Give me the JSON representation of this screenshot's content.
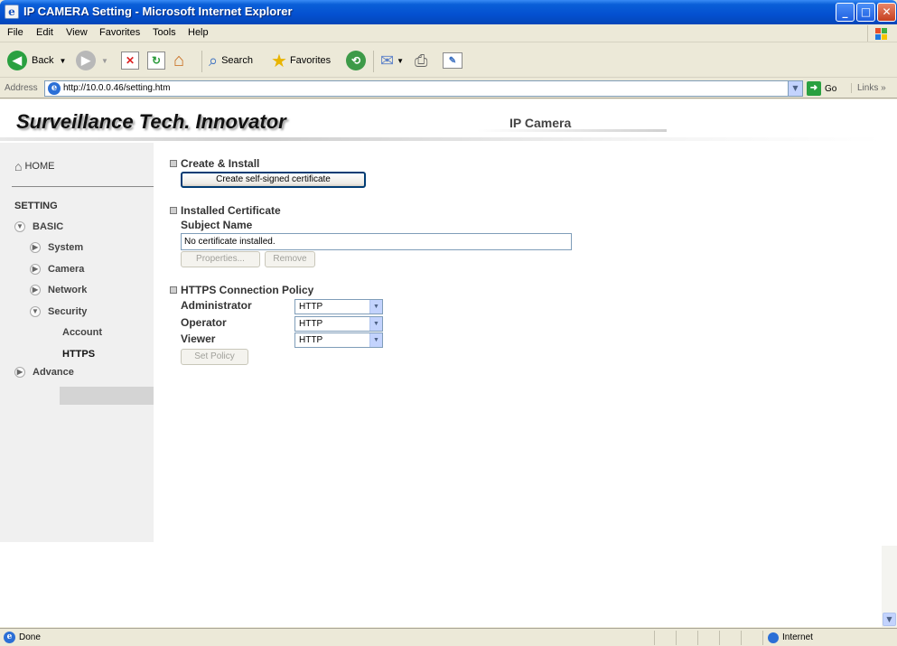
{
  "window": {
    "title": "IP CAMERA Setting - Microsoft Internet Explorer"
  },
  "menu": [
    "File",
    "Edit",
    "View",
    "Favorites",
    "Tools",
    "Help"
  ],
  "toolbar": {
    "back": "Back",
    "search": "Search",
    "favorites": "Favorites"
  },
  "address": {
    "label": "Address",
    "url": "http://10.0.0.46/setting.htm",
    "go": "Go",
    "links": "Links"
  },
  "banner": {
    "title": "Surveillance Tech. Innovator",
    "product": "IP Camera"
  },
  "sidebar": {
    "home": "HOME",
    "setting": "SETTING",
    "basic": "BASIC",
    "system": "System",
    "camera": "Camera",
    "network": "Network",
    "security": "Security",
    "account": "Account",
    "https": "HTTPS",
    "advance": "Advance"
  },
  "create": {
    "heading": "Create & Install",
    "button": "Create self-signed certificate"
  },
  "installed": {
    "heading": "Installed Certificate",
    "subject_label": "Subject Name",
    "subject_value": "No certificate installed.",
    "properties": "Properties...",
    "remove": "Remove"
  },
  "policy": {
    "heading": "HTTPS Connection Policy",
    "administrator_label": "Administrator",
    "administrator_value": "HTTP",
    "operator_label": "Operator",
    "operator_value": "HTTP",
    "viewer_label": "Viewer",
    "viewer_value": "HTTP",
    "set_policy": "Set Policy"
  },
  "status": {
    "text": "Done",
    "zone": "Internet"
  }
}
